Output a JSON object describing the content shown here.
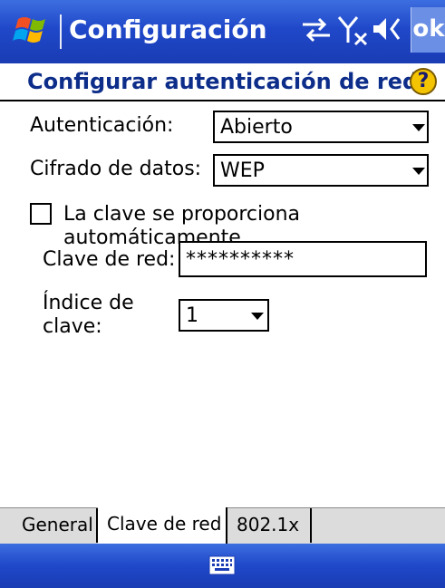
{
  "titlebar": {
    "app_title": "Configuración",
    "ok_label": "ok",
    "icons": [
      "windows-start-icon",
      "connectivity-icon",
      "signal-off-icon",
      "speaker-icon"
    ]
  },
  "header": {
    "page_title": "Configurar autenticación de red",
    "help_icon_glyph": "?"
  },
  "form": {
    "auth_label": "Autenticación:",
    "auth_value": "Abierto",
    "encryption_label": "Cifrado de datos:",
    "encryption_value": "WEP",
    "auto_key_label": "La clave se proporciona automáticamente",
    "auto_key_checked": false,
    "network_key_label": "Clave de red:",
    "network_key_value": "**********",
    "key_index_label_line1": "Índice de",
    "key_index_label_line2": "clave:",
    "key_index_value": "1"
  },
  "tabs": [
    {
      "label": "General",
      "active": false
    },
    {
      "label": "Clave de red",
      "active": true
    },
    {
      "label": "802.1x",
      "active": false
    }
  ],
  "menubar": {
    "icon": "keyboard-icon"
  },
  "colors": {
    "titlebar_blue": "#1f48c9",
    "title_text": "#0d2d8a",
    "help_yellow": "#f4c400"
  }
}
